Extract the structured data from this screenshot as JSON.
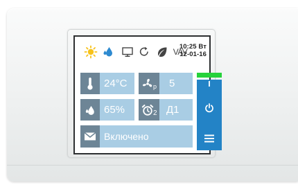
{
  "status": {
    "icons": [
      "sun-icon",
      "water-drop-icon",
      "monitor-icon",
      "refresh-icon",
      "leaf-icon",
      "vav-icon"
    ],
    "vav_label": "VAV",
    "time": "10:25 Вт",
    "date": "12-01-16"
  },
  "tiles": {
    "temperature": "24°C",
    "fan_value": "5",
    "fan_subscript": "p",
    "humidity": "65%",
    "alarm_value": "Д1",
    "alarm_subscript": "2",
    "message": "Включено"
  },
  "colors": {
    "tile_bg": "#a9cde4",
    "icon_bg": "#6d8596",
    "accent_blue": "#2383c6",
    "power_indicator": "#26d23b",
    "sun": "#f7c21a",
    "drop": "#2e8ad0"
  }
}
